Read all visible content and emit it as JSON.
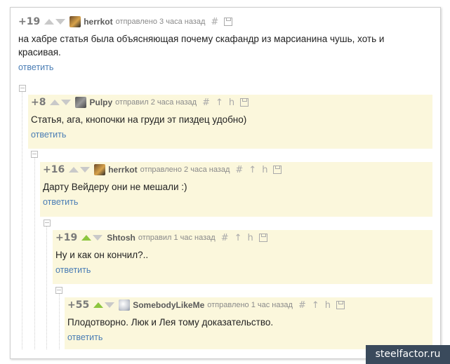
{
  "reply_label": "ответить",
  "comments": [
    {
      "rating": "+19",
      "author": "herrkot",
      "meta": "отправлено 3 часа назад",
      "text": "на хабре статья была объясняющая почему скафандр из марсианина чушь, хоть и красивая."
    },
    {
      "rating": "+8",
      "author": "Pulpy",
      "meta": "отправил 2 часа назад",
      "text": "Статья, ага, кнопочки на груди эт пиздец удобно)"
    },
    {
      "rating": "+16",
      "author": "herrkot",
      "meta": "отправлено 2 часа назад",
      "text": "Дарту Вейдеру они не мешали :)"
    },
    {
      "rating": "+19",
      "author": "Shtosh",
      "meta": "отправил 1 час назад",
      "text": "Ну и как он кончил?.."
    },
    {
      "rating": "+55",
      "author": "SomebodyLikeMe",
      "meta": "отправлено 1 час назад",
      "text": "Плодотворно. Люк и Лея тому доказательство."
    }
  ],
  "icons": {
    "link": "#",
    "up_to_parent": "↑",
    "tree": "h"
  },
  "colors": {
    "highlight": "#fbf7dc",
    "reply_link": "#4a7db5",
    "upvote_active": "#8dc63f"
  },
  "watermark": "steelfactor.ru"
}
